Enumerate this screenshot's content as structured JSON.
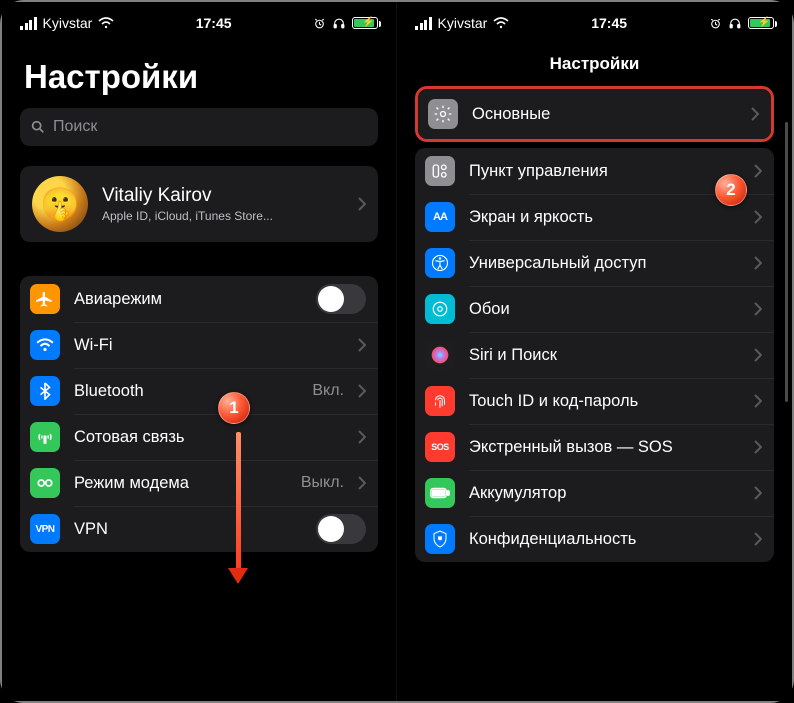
{
  "statusbar": {
    "carrier": "Kyivstar",
    "time": "17:45"
  },
  "left": {
    "title": "Настройки",
    "search_placeholder": "Поиск",
    "profile": {
      "name": "Vitaliy Kairov",
      "subtitle": "Apple ID, iCloud, iTunes Store..."
    },
    "rows": {
      "airplane": "Авиарежим",
      "wifi": "Wi-Fi",
      "bluetooth": "Bluetooth",
      "bluetooth_value": "Вкл.",
      "cellular": "Сотовая связь",
      "hotspot": "Режим модема",
      "hotspot_value": "Выкл.",
      "vpn": "VPN",
      "vpn_icon_text": "VPN"
    },
    "callouts": {
      "one": "1"
    }
  },
  "right": {
    "nav_title": "Настройки",
    "rows": {
      "general": "Основные",
      "control_center": "Пункт управления",
      "display": "Экран и яркость",
      "display_icon_text": "AA",
      "accessibility": "Универсальный доступ",
      "wallpaper": "Обои",
      "siri": "Siri и Поиск",
      "touchid": "Touch ID и код-пароль",
      "sos": "Экстренный вызов — SOS",
      "sos_icon_text": "SOS",
      "battery": "Аккумулятор",
      "privacy": "Конфиденциальность"
    },
    "callouts": {
      "two": "2"
    }
  }
}
